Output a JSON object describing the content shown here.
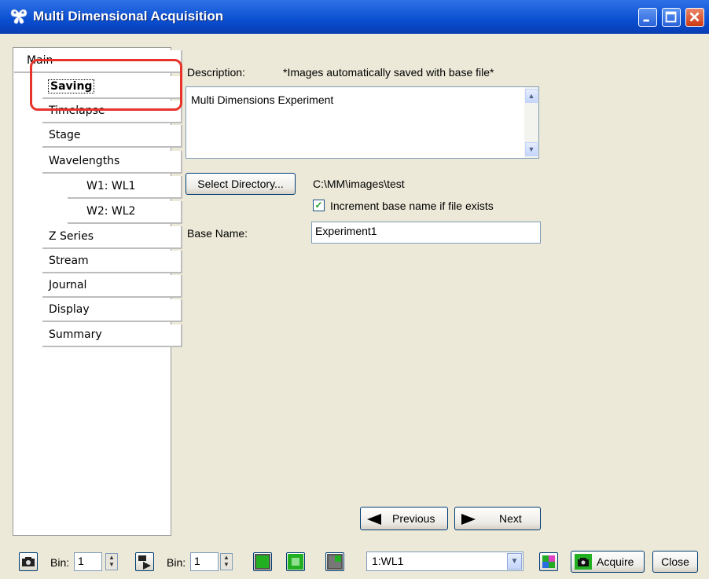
{
  "window": {
    "title": "Multi Dimensional Acquisition",
    "app_icon": "butterfly-icon",
    "controls": [
      "minimize-icon",
      "maximize-icon",
      "close-icon"
    ]
  },
  "nav": {
    "main": "Main",
    "items": [
      {
        "label": "Saving",
        "selected": true
      },
      {
        "label": "Timelapse"
      },
      {
        "label": "Stage"
      },
      {
        "label": "Wavelengths"
      },
      {
        "label": "W1: WL1"
      },
      {
        "label": "W2: WL2"
      },
      {
        "label": "Z Series"
      },
      {
        "label": "Stream"
      },
      {
        "label": "Journal"
      },
      {
        "label": "Display"
      },
      {
        "label": "Summary"
      }
    ]
  },
  "saving": {
    "description_label": "Description:",
    "note": "*Images automatically saved with base file*",
    "description_value": "Multi Dimensions Experiment",
    "select_directory_label": "Select Directory...",
    "directory_path": "C:\\MM\\images\\test",
    "increment_label": "Increment base name if file exists",
    "increment_checked": true,
    "base_name_label": "Base Name:",
    "base_name_value": "Experiment1"
  },
  "navigation": {
    "previous_label": "Previous",
    "next_label": "Next"
  },
  "bottombar": {
    "bin1_label": "Bin:",
    "bin1_value": "1",
    "bin2_label": "Bin:",
    "bin2_value": "1",
    "wavelength_selected": "1:WL1",
    "acquire_label": "Acquire",
    "close_label": "Close"
  },
  "colors": {
    "titlebar": "#0a4fd1",
    "highlight": "#e8332a",
    "window_bg": "#ece9d8",
    "accent_green": "#22b022"
  }
}
